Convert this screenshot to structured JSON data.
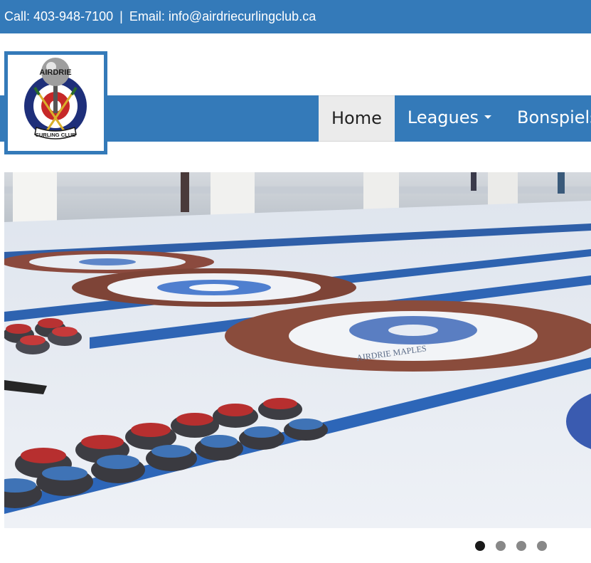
{
  "contact": {
    "phone_text": "Call: 403-948-7100",
    "separator": "|",
    "email_text": "Email: info@airdriecurlingclub.ca"
  },
  "logo": {
    "top_text": "AIRDRIE",
    "bottom_text": "CURLING CLUB"
  },
  "nav": {
    "items": [
      {
        "label": "Home",
        "active": true
      },
      {
        "label": "Leagues",
        "has_dropdown": true
      },
      {
        "label": "Bonspiels"
      }
    ]
  },
  "slider": {
    "slide_count": 4,
    "active_index": 0,
    "house_text": "AIRDRIE MAPLES"
  },
  "colors": {
    "brand_blue": "#347ab9",
    "active_nav_bg": "#ebebeb"
  }
}
